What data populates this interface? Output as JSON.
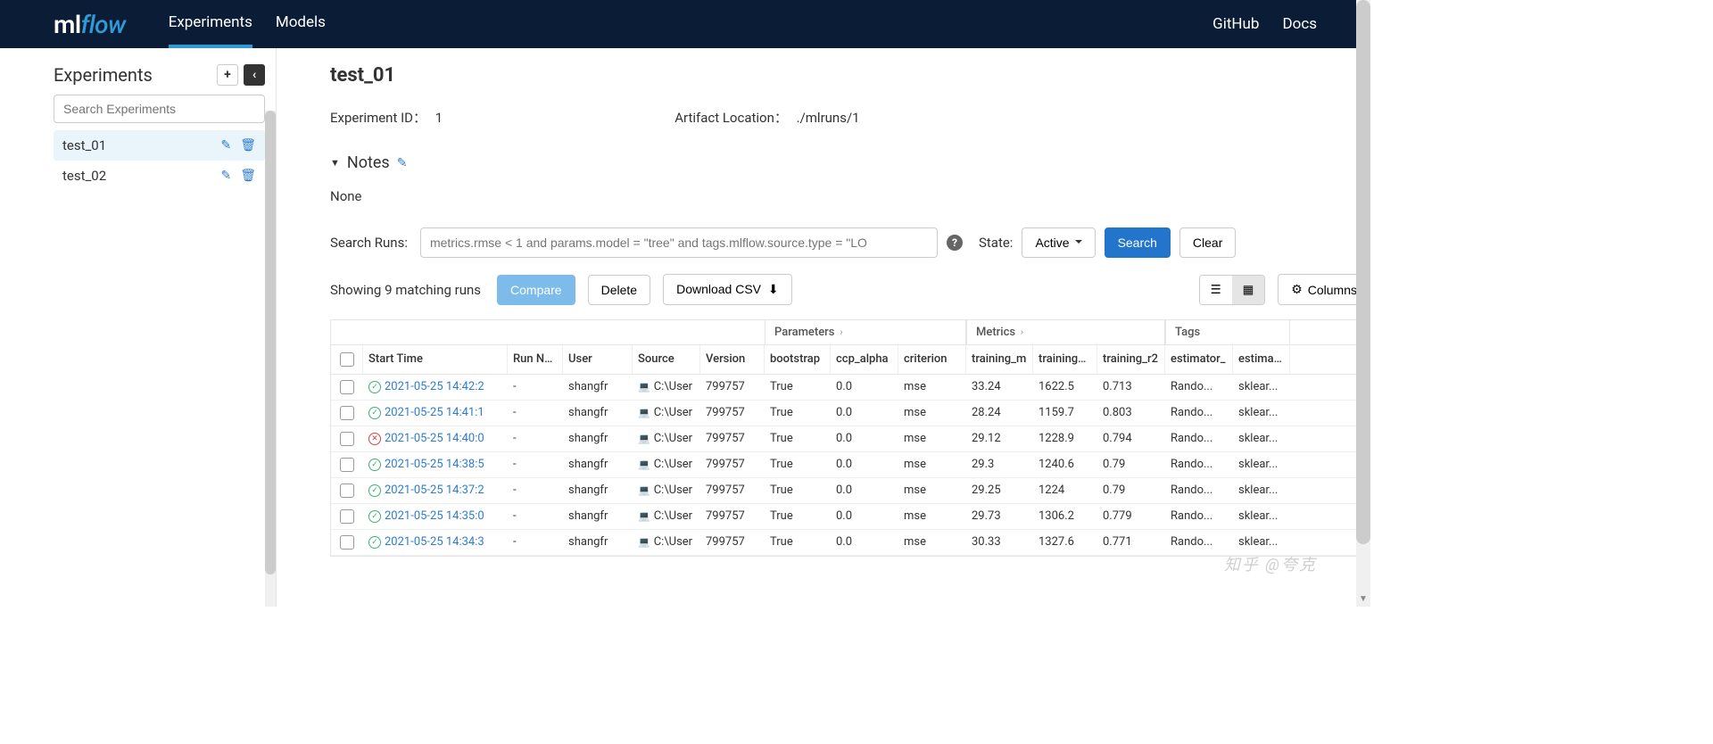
{
  "header": {
    "logo_ml": "ml",
    "logo_flow": "flow",
    "tabs": [
      "Experiments",
      "Models"
    ],
    "active_tab": 0,
    "links": [
      "GitHub",
      "Docs"
    ]
  },
  "sidebar": {
    "title": "Experiments",
    "search_placeholder": "Search Experiments",
    "items": [
      {
        "name": "test_01",
        "active": true
      },
      {
        "name": "test_02",
        "active": false
      }
    ]
  },
  "main": {
    "title": "test_01",
    "experiment_id_label": "Experiment ID：",
    "experiment_id": "1",
    "artifact_label": "Artifact Location：",
    "artifact_location": "./mlruns/1",
    "notes_label": "Notes",
    "notes_body": "None",
    "search_label": "Search Runs:",
    "search_placeholder": "metrics.rmse < 1 and params.model = \"tree\" and tags.mlflow.source.type = \"LO",
    "state_label": "State:",
    "state_value": "Active",
    "search_button": "Search",
    "clear_button": "Clear",
    "showing_text": "Showing 9 matching runs",
    "compare": "Compare",
    "delete": "Delete",
    "download_csv": "Download CSV",
    "columns_btn": "Columns"
  },
  "table": {
    "group_parameters": "Parameters",
    "group_metrics": "Metrics",
    "group_tags": "Tags",
    "cols": {
      "start": "Start Time",
      "run": "Run Name",
      "user": "User",
      "source": "Source",
      "version": "Version",
      "bootstrap": "bootstrap",
      "ccp_alpha": "ccp_alpha",
      "criterion": "criterion",
      "m1": "training_m",
      "m2": "training_m",
      "m3": "training_r2",
      "t1": "estimator_",
      "t2": "estimator_"
    },
    "rows": [
      {
        "status": "ok",
        "start": "2021-05-25 14:42:2",
        "run": "-",
        "user": "shangfr",
        "src": "C:\\User",
        "ver": "799757",
        "boot": "True",
        "ccp": "0.0",
        "crit": "mse",
        "m1": "33.24",
        "m2": "1622.5",
        "m3": "0.713",
        "t1": "Rando...",
        "t2": "sklear..."
      },
      {
        "status": "ok",
        "start": "2021-05-25 14:41:1",
        "run": "-",
        "user": "shangfr",
        "src": "C:\\User",
        "ver": "799757",
        "boot": "True",
        "ccp": "0.0",
        "crit": "mse",
        "m1": "28.24",
        "m2": "1159.7",
        "m3": "0.803",
        "t1": "Rando...",
        "t2": "sklear..."
      },
      {
        "status": "fail",
        "start": "2021-05-25 14:40:0",
        "run": "-",
        "user": "shangfr",
        "src": "C:\\User",
        "ver": "799757",
        "boot": "True",
        "ccp": "0.0",
        "crit": "mse",
        "m1": "29.12",
        "m2": "1228.9",
        "m3": "0.794",
        "t1": "Rando...",
        "t2": "sklear..."
      },
      {
        "status": "ok",
        "start": "2021-05-25 14:38:5",
        "run": "-",
        "user": "shangfr",
        "src": "C:\\User",
        "ver": "799757",
        "boot": "True",
        "ccp": "0.0",
        "crit": "mse",
        "m1": "29.3",
        "m2": "1240.6",
        "m3": "0.79",
        "t1": "Rando...",
        "t2": "sklear..."
      },
      {
        "status": "ok",
        "start": "2021-05-25 14:37:2",
        "run": "-",
        "user": "shangfr",
        "src": "C:\\User",
        "ver": "799757",
        "boot": "True",
        "ccp": "0.0",
        "crit": "mse",
        "m1": "29.25",
        "m2": "1224",
        "m3": "0.79",
        "t1": "Rando...",
        "t2": "sklear..."
      },
      {
        "status": "ok",
        "start": "2021-05-25 14:35:0",
        "run": "-",
        "user": "shangfr",
        "src": "C:\\User",
        "ver": "799757",
        "boot": "True",
        "ccp": "0.0",
        "crit": "mse",
        "m1": "29.73",
        "m2": "1306.2",
        "m3": "0.779",
        "t1": "Rando...",
        "t2": "sklear..."
      },
      {
        "status": "ok",
        "start": "2021-05-25 14:34:3",
        "run": "-",
        "user": "shangfr",
        "src": "C:\\User",
        "ver": "799757",
        "boot": "True",
        "ccp": "0.0",
        "crit": "mse",
        "m1": "30.33",
        "m2": "1327.6",
        "m3": "0.771",
        "t1": "Rando...",
        "t2": "sklear..."
      }
    ]
  },
  "watermark": "知乎 @夸克"
}
